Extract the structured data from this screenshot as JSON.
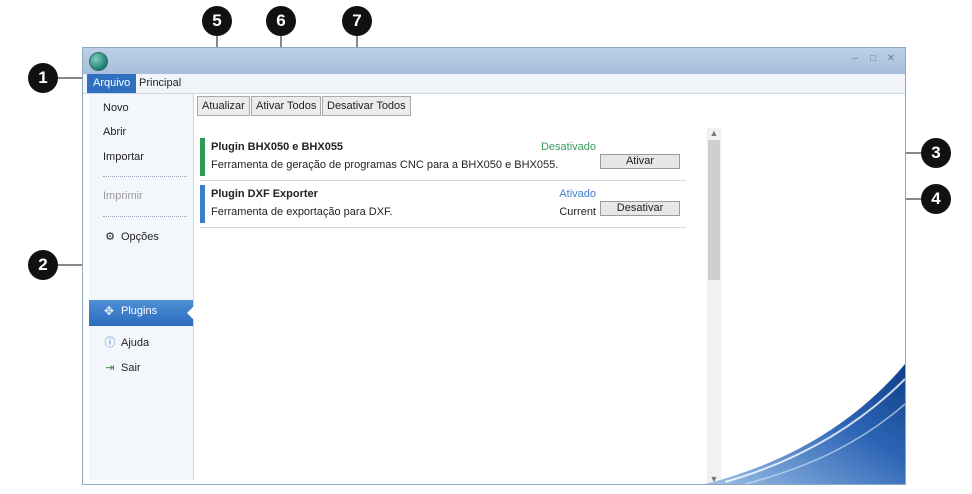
{
  "window": {
    "menu_tabs": [
      {
        "label": "Arquivo"
      },
      {
        "label": "Principal"
      }
    ]
  },
  "sidebar": {
    "items": [
      {
        "label": "Novo"
      },
      {
        "label": "Abrir"
      },
      {
        "label": "Importar"
      },
      {
        "label": "Imprimir"
      },
      {
        "label": "Opções",
        "icon": "gear-icon"
      },
      {
        "label": "Plugins",
        "icon": "puzzle-icon"
      },
      {
        "label": "Ajuda",
        "icon": "help-icon"
      },
      {
        "label": "Sair",
        "icon": "exit-icon"
      }
    ]
  },
  "toolbar": {
    "refresh_label": "Atualizar",
    "enable_all_label": "Ativar Todos",
    "disable_all_label": "Desativar Todos"
  },
  "plugins": [
    {
      "title": "Plugin BHX050 e BHX055",
      "description": "Ferramenta de geração de programas CNC para a BHX050 e BHX055.",
      "status": "Desativado",
      "version": "",
      "action_label": "Ativar",
      "status_color": "#3a9a5c",
      "bar_color": "#2e9a54"
    },
    {
      "title": "Plugin DXF Exporter",
      "description": "Ferramenta de exportação para DXF.",
      "status": "Ativado",
      "version": "Current",
      "action_label": "Desativar",
      "status_color": "#3f7fd0",
      "bar_color": "#3d7ec9"
    }
  ],
  "callouts": [
    "1",
    "2",
    "3",
    "4",
    "5",
    "6",
    "7"
  ],
  "colors": {
    "accent": "#2f6fbf",
    "titlebar": "#a7bfdb"
  }
}
